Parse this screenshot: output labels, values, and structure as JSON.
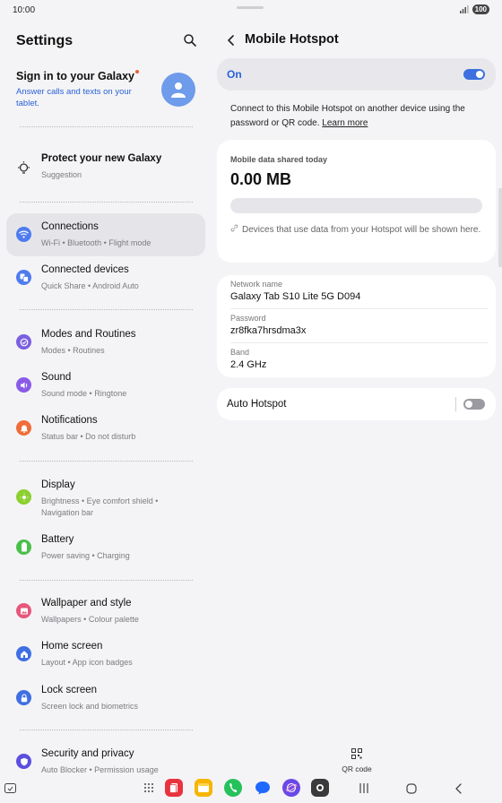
{
  "status_bar": {
    "time": "10:00",
    "battery": "100"
  },
  "left_pane": {
    "title": "Settings",
    "account": {
      "title": "Sign in to your Galaxy",
      "subtitle": "Answer calls and texts on your tablet."
    },
    "suggestion": {
      "title": "Protect your new Galaxy",
      "subtitle": "Suggestion"
    },
    "items": [
      {
        "title": "Connections",
        "subtitle": "Wi-Fi  •  Bluetooth  •  Flight mode",
        "icon": "wifi-icon",
        "color": "#4f7bef"
      },
      {
        "title": "Connected devices",
        "subtitle": "Quick Share  •  Android Auto",
        "icon": "connected-devices-icon",
        "color": "#4f7bef"
      },
      {
        "title": "Modes and Routines",
        "subtitle": "Modes  •  Routines",
        "icon": "modes-icon",
        "color": "#7b5fe0"
      },
      {
        "title": "Sound",
        "subtitle": "Sound mode  •  Ringtone",
        "icon": "sound-icon",
        "color": "#8a5be8"
      },
      {
        "title": "Notifications",
        "subtitle": "Status bar  •  Do not disturb",
        "icon": "notification-icon",
        "color": "#f06c3b"
      },
      {
        "title": "Display",
        "subtitle": "Brightness  •  Eye comfort shield  •",
        "subtitle2": "Navigation bar",
        "icon": "display-icon",
        "color": "#8ccf2f"
      },
      {
        "title": "Battery",
        "subtitle": "Power saving  •  Charging",
        "icon": "battery-icon",
        "color": "#4bbf4b"
      },
      {
        "title": "Wallpaper and style",
        "subtitle": "Wallpapers  •  Colour palette",
        "icon": "wallpaper-icon",
        "color": "#e6577b"
      },
      {
        "title": "Home screen",
        "subtitle": "Layout  •  App icon badges",
        "icon": "home-screen-icon",
        "color": "#3f6fe3"
      },
      {
        "title": "Lock screen",
        "subtitle": "Screen lock and biometrics",
        "icon": "lock-icon",
        "color": "#3f6fe3"
      },
      {
        "title": "Security and privacy",
        "subtitle": "Auto Blocker  •  Permission usage",
        "icon": "shield-icon",
        "color": "#5b4fe0"
      }
    ]
  },
  "right_pane": {
    "title": "Mobile Hotspot",
    "master_toggle": {
      "label": "On",
      "state": "on"
    },
    "info": {
      "text": "Connect to this Mobile Hotspot on another device using the password or QR code.",
      "link": "Learn more"
    },
    "usage": {
      "label": "Mobile data shared today",
      "value": "0.00 MB",
      "note": "Devices that use data from your Hotspot will be shown here."
    },
    "network": {
      "name_label": "Network name",
      "name": "Galaxy Tab S10 Lite 5G D094",
      "password_label": "Password",
      "password": "zr8fka7hrsdma3x",
      "band_label": "Band",
      "band": "2.4 GHz"
    },
    "auto_hotspot": {
      "label": "Auto Hotspot",
      "state": "off"
    },
    "qr_button": "QR code"
  },
  "colors": {
    "accent": "#3e6fe0",
    "link": "#2a62d8",
    "notify_dot": "#f25d33"
  }
}
